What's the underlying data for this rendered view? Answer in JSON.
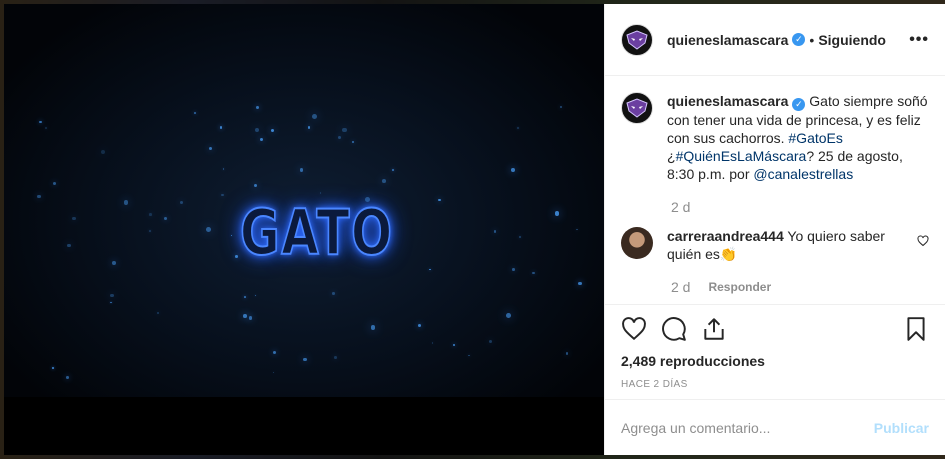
{
  "media": {
    "video_text": "GATO"
  },
  "post_header": {
    "username": "quieneslamascara",
    "verified_icon": "verified-badge-icon",
    "separator": "•",
    "follow_status": "Siguiendo",
    "more_label": "•••"
  },
  "caption": {
    "username": "quieneslamascara",
    "text_1": " Gato siempre soñó con tener una vida de princesa, y es feliz con sus cachorros. ",
    "hashtag_1": "#GatoEs",
    "text_2": " ¿",
    "hashtag_2": "#QuiénEsLaMáscara",
    "text_3": "? 25 de agosto, 8:30 p.m. por ",
    "mention": "@canalestrellas",
    "time": "2 d"
  },
  "comment": {
    "username": "carreraandrea444",
    "text": " Yo quiero saber quién es👏",
    "time": "2 d",
    "reply_label": "Responder"
  },
  "actions": {
    "views": "2,489 reproducciones",
    "posted_ago": "HACE 2 DÍAS"
  },
  "add_comment": {
    "placeholder": "Agrega un comentario...",
    "publish_label": "Publicar"
  },
  "colors": {
    "accent": "#3897f0",
    "link": "#003569",
    "muted": "#8e8e8e",
    "publish_disabled": "#b2dffc",
    "neon_blue": "#4a86ff"
  }
}
